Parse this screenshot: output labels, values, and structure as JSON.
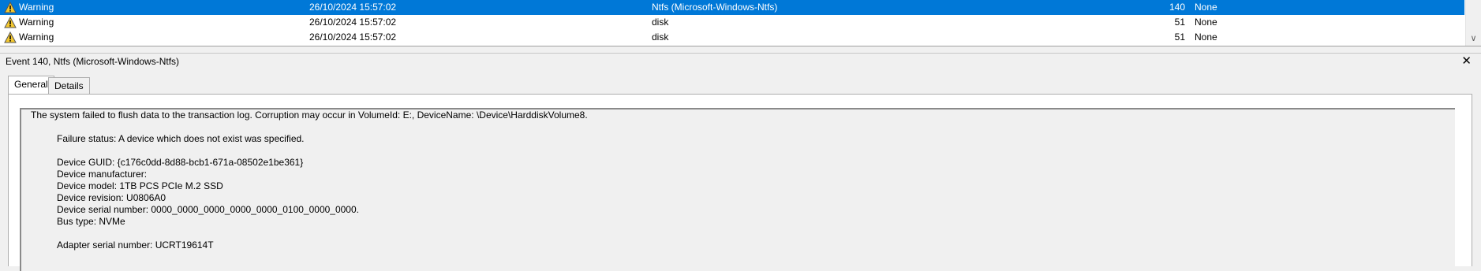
{
  "events": [
    {
      "level": "Warning",
      "date": "26/10/2024 15:57:02",
      "source": "Ntfs (Microsoft-Windows-Ntfs)",
      "event_id": "140",
      "task": "None",
      "selected": true
    },
    {
      "level": "Warning",
      "date": "26/10/2024 15:57:02",
      "source": "disk",
      "event_id": "51",
      "task": "None",
      "selected": false
    },
    {
      "level": "Warning",
      "date": "26/10/2024 15:57:02",
      "source": "disk",
      "event_id": "51",
      "task": "None",
      "selected": false
    }
  ],
  "detail": {
    "title": "Event 140, Ntfs (Microsoft-Windows-Ntfs)",
    "tabs": [
      "General",
      "Details"
    ],
    "description": {
      "line1": "The system failed to flush data to the transaction log. Corruption may occur in VolumeId: E:, DeviceName: \\Device\\HarddiskVolume8.",
      "failure_status": "Failure status: A device which does not exist was specified.",
      "device_guid": "Device GUID: {c176c0dd-8d88-bcb1-671a-08502e1be361}",
      "device_manufacturer": "Device manufacturer:",
      "device_model": "Device model: 1TB PCS PCIe M.2 SSD",
      "device_revision": "Device revision: U0806A0",
      "device_serial": "Device serial number: 0000_0000_0000_0000_0000_0100_0000_0000.",
      "bus_type": "Bus type: NVMe",
      "adapter_serial": "Adapter serial number: UCRT19614T"
    }
  },
  "icons": {
    "warning": "warning-icon",
    "close": "close-icon",
    "scroll_down": "chevron-down-icon"
  },
  "colors": {
    "selection": "#0078d7",
    "warning_fill": "#f4c82f"
  }
}
